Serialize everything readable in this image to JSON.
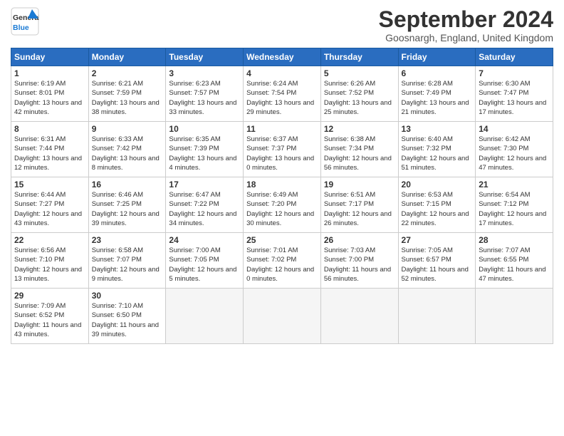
{
  "header": {
    "logo_general": "General",
    "logo_blue": "Blue",
    "month_title": "September 2024",
    "location": "Goosnargh, England, United Kingdom"
  },
  "days_of_week": [
    "Sunday",
    "Monday",
    "Tuesday",
    "Wednesday",
    "Thursday",
    "Friday",
    "Saturday"
  ],
  "weeks": [
    [
      {
        "day": "1",
        "sunrise": "6:19 AM",
        "sunset": "8:01 PM",
        "daylight": "13 hours and 42 minutes."
      },
      {
        "day": "2",
        "sunrise": "6:21 AM",
        "sunset": "7:59 PM",
        "daylight": "13 hours and 38 minutes."
      },
      {
        "day": "3",
        "sunrise": "6:23 AM",
        "sunset": "7:57 PM",
        "daylight": "13 hours and 33 minutes."
      },
      {
        "day": "4",
        "sunrise": "6:24 AM",
        "sunset": "7:54 PM",
        "daylight": "13 hours and 29 minutes."
      },
      {
        "day": "5",
        "sunrise": "6:26 AM",
        "sunset": "7:52 PM",
        "daylight": "13 hours and 25 minutes."
      },
      {
        "day": "6",
        "sunrise": "6:28 AM",
        "sunset": "7:49 PM",
        "daylight": "13 hours and 21 minutes."
      },
      {
        "day": "7",
        "sunrise": "6:30 AM",
        "sunset": "7:47 PM",
        "daylight": "13 hours and 17 minutes."
      }
    ],
    [
      {
        "day": "8",
        "sunrise": "6:31 AM",
        "sunset": "7:44 PM",
        "daylight": "13 hours and 12 minutes."
      },
      {
        "day": "9",
        "sunrise": "6:33 AM",
        "sunset": "7:42 PM",
        "daylight": "13 hours and 8 minutes."
      },
      {
        "day": "10",
        "sunrise": "6:35 AM",
        "sunset": "7:39 PM",
        "daylight": "13 hours and 4 minutes."
      },
      {
        "day": "11",
        "sunrise": "6:37 AM",
        "sunset": "7:37 PM",
        "daylight": "13 hours and 0 minutes."
      },
      {
        "day": "12",
        "sunrise": "6:38 AM",
        "sunset": "7:34 PM",
        "daylight": "12 hours and 56 minutes."
      },
      {
        "day": "13",
        "sunrise": "6:40 AM",
        "sunset": "7:32 PM",
        "daylight": "12 hours and 51 minutes."
      },
      {
        "day": "14",
        "sunrise": "6:42 AM",
        "sunset": "7:30 PM",
        "daylight": "12 hours and 47 minutes."
      }
    ],
    [
      {
        "day": "15",
        "sunrise": "6:44 AM",
        "sunset": "7:27 PM",
        "daylight": "12 hours and 43 minutes."
      },
      {
        "day": "16",
        "sunrise": "6:46 AM",
        "sunset": "7:25 PM",
        "daylight": "12 hours and 39 minutes."
      },
      {
        "day": "17",
        "sunrise": "6:47 AM",
        "sunset": "7:22 PM",
        "daylight": "12 hours and 34 minutes."
      },
      {
        "day": "18",
        "sunrise": "6:49 AM",
        "sunset": "7:20 PM",
        "daylight": "12 hours and 30 minutes."
      },
      {
        "day": "19",
        "sunrise": "6:51 AM",
        "sunset": "7:17 PM",
        "daylight": "12 hours and 26 minutes."
      },
      {
        "day": "20",
        "sunrise": "6:53 AM",
        "sunset": "7:15 PM",
        "daylight": "12 hours and 22 minutes."
      },
      {
        "day": "21",
        "sunrise": "6:54 AM",
        "sunset": "7:12 PM",
        "daylight": "12 hours and 17 minutes."
      }
    ],
    [
      {
        "day": "22",
        "sunrise": "6:56 AM",
        "sunset": "7:10 PM",
        "daylight": "12 hours and 13 minutes."
      },
      {
        "day": "23",
        "sunrise": "6:58 AM",
        "sunset": "7:07 PM",
        "daylight": "12 hours and 9 minutes."
      },
      {
        "day": "24",
        "sunrise": "7:00 AM",
        "sunset": "7:05 PM",
        "daylight": "12 hours and 5 minutes."
      },
      {
        "day": "25",
        "sunrise": "7:01 AM",
        "sunset": "7:02 PM",
        "daylight": "12 hours and 0 minutes."
      },
      {
        "day": "26",
        "sunrise": "7:03 AM",
        "sunset": "7:00 PM",
        "daylight": "11 hours and 56 minutes."
      },
      {
        "day": "27",
        "sunrise": "7:05 AM",
        "sunset": "6:57 PM",
        "daylight": "11 hours and 52 minutes."
      },
      {
        "day": "28",
        "sunrise": "7:07 AM",
        "sunset": "6:55 PM",
        "daylight": "11 hours and 47 minutes."
      }
    ],
    [
      {
        "day": "29",
        "sunrise": "7:09 AM",
        "sunset": "6:52 PM",
        "daylight": "11 hours and 43 minutes."
      },
      {
        "day": "30",
        "sunrise": "7:10 AM",
        "sunset": "6:50 PM",
        "daylight": "11 hours and 39 minutes."
      },
      null,
      null,
      null,
      null,
      null
    ]
  ]
}
